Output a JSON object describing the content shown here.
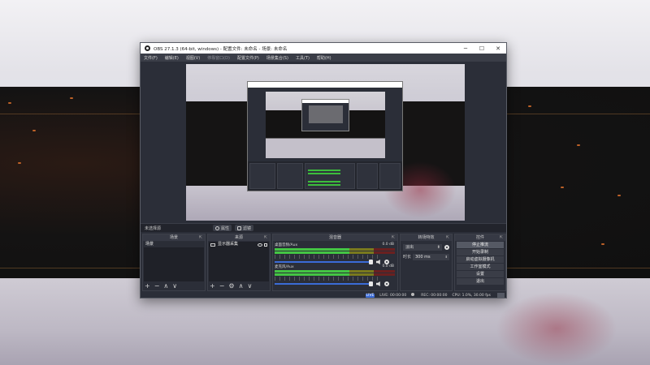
{
  "window": {
    "title": "OBS 27.1.3 (64-bit, windows) - 配置文件: 未命名 - 场景: 未命名",
    "minimize_glyph": "─",
    "maximize_glyph": "☐",
    "close_glyph": "✕"
  },
  "menu": [
    "文件(F)",
    "编辑(E)",
    "视图(V)",
    "停靠窗口(D)",
    "配置文件(P)",
    "场景集合(S)",
    "工具(T)",
    "帮助(H)"
  ],
  "source_toolbar": {
    "no_selection": "未选择源",
    "properties_label": "属性",
    "filters_label": "滤镜"
  },
  "scenes": {
    "header": "场景",
    "items": [
      "场景"
    ],
    "footer": [
      "+",
      "−",
      "∧",
      "∨"
    ]
  },
  "sources": {
    "header": "来源",
    "items": [
      "显示器采集"
    ],
    "footer": [
      "+",
      "−",
      "⚙",
      "∧",
      "∨"
    ]
  },
  "mixer": {
    "header": "混音器",
    "tracks": [
      {
        "name": "桌面音频/Aux",
        "db": "0.0 dB"
      },
      {
        "name": "麦克风/Aux",
        "db": "0.0 dB"
      }
    ]
  },
  "transitions": {
    "header": "转场特效",
    "selected": "淡出",
    "duration_label": "时长",
    "duration_value": "300 ms"
  },
  "controls": {
    "header": "控件",
    "buttons": [
      "停止推流",
      "开始录制",
      "启动虚拟摄像机",
      "工作室模式",
      "设置",
      "退出"
    ]
  },
  "status": {
    "live_badge": "LIVE",
    "live_time": "LIVE: 00:00:00",
    "rec_time": "REC: 00:00:00",
    "cpu": "CPU: 1.0%, 30.00 fps"
  },
  "icons": {
    "pin": "⇱",
    "dropdown": "⬍",
    "speaker": "speaker-icon",
    "gear": "gear-icon",
    "eye": "eye-icon",
    "lock": "lock-icon",
    "monitor": "monitor-icon"
  }
}
